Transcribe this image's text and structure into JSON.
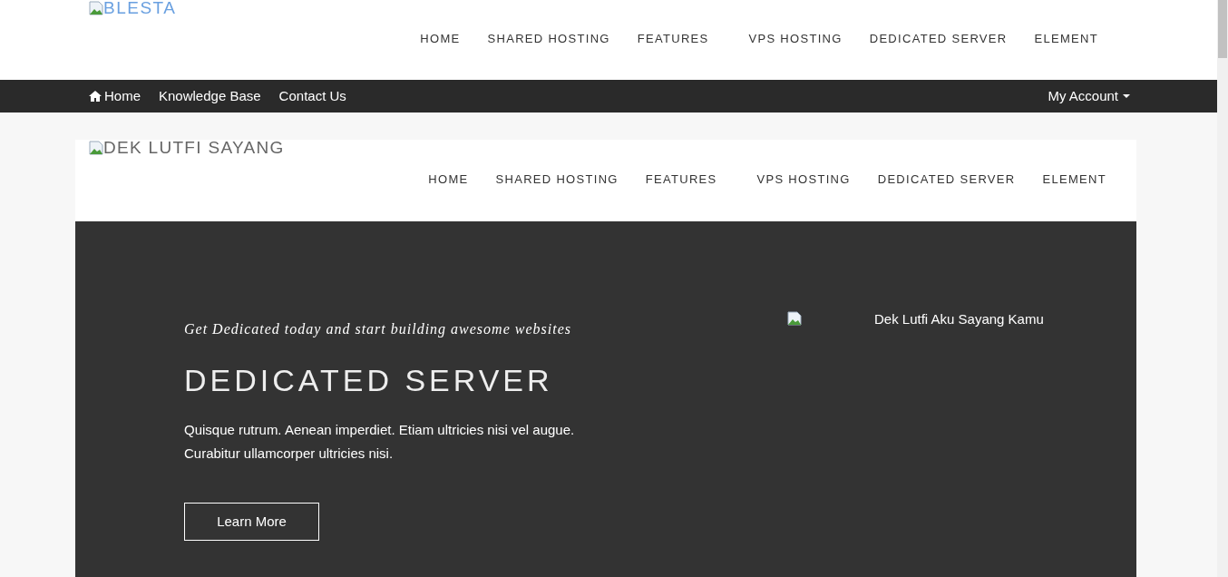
{
  "top_header": {
    "logo_alt": "BLESTA",
    "nav": [
      "HOME",
      "SHARED HOSTING",
      "FEATURES",
      "VPS HOSTING",
      "DEDICATED SERVER",
      "ELEMENT"
    ]
  },
  "top_bar": {
    "links": [
      {
        "label": "Home",
        "kind": "home"
      },
      {
        "label": "Knowledge Base",
        "kind": "text"
      },
      {
        "label": "Contact Us",
        "kind": "text"
      }
    ],
    "account": "My Account"
  },
  "site_header": {
    "logo_alt": "DEK LUTFI SAYANG",
    "nav": [
      "HOME",
      "SHARED HOSTING",
      "FEATURES",
      "VPS HOSTING",
      "DEDICATED SERVER",
      "ELEMENT"
    ]
  },
  "hero": {
    "tagline": "Get Dedicated today and start building awesome websites",
    "title": "DEDICATED SERVER",
    "text": "Quisque rutrum. Aenean imperdiet. Etiam ultricies nisi vel augue. Curabitur ullamcorper ultricies nisi.",
    "button": "Learn More",
    "image_caption": "Dek Lutfi Aku Sayang Kamu"
  }
}
